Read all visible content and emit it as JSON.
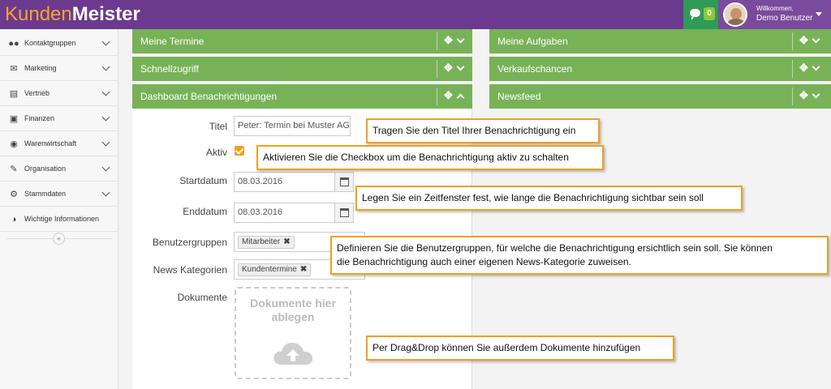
{
  "app": {
    "logo_part1": "Kunden",
    "logo_part2": "Meister",
    "chat_count": "0",
    "welcome": "Willkommen,",
    "username": "Demo Benutzer"
  },
  "sidebar": {
    "items": [
      {
        "label": "Kontaktgruppen",
        "icon": "users-icon"
      },
      {
        "label": "Marketing",
        "icon": "envelope-icon"
      },
      {
        "label": "Vertrieb",
        "icon": "bar-chart-icon"
      },
      {
        "label": "Finanzen",
        "icon": "money-icon"
      },
      {
        "label": "Warenwirtschaft",
        "icon": "globe-icon"
      },
      {
        "label": "Organisation",
        "icon": "edit-icon"
      },
      {
        "label": "Stammdaten",
        "icon": "cogs-icon"
      },
      {
        "label": "Wichtige Informationen",
        "icon": "half-circle-icon"
      }
    ],
    "collapse_glyph": "«"
  },
  "panels": {
    "left": [
      "Meine Termine",
      "Schnellzugriff",
      "Dashboard Benachrichtigungen"
    ],
    "right": [
      "Meine Aufgaben",
      "Verkaufschancen",
      "Newsfeed"
    ]
  },
  "form": {
    "title_label": "Titel",
    "title_value": "Peter: Termin bei Muster AG",
    "active_label": "Aktiv",
    "active_checked": true,
    "start_label": "Startdatum",
    "start_value": "08.03.2016",
    "end_label": "Enddatum",
    "end_value": "08.03.2016",
    "groups_label": "Benutzergruppen",
    "groups_tag": "Mitarbeiter",
    "news_label": "News Kategorien",
    "news_tag": "Kundentermine",
    "docs_label": "Dokumente",
    "dropzone_text_1": "Dokumente hier",
    "dropzone_text_2": "ablegen",
    "tag_remove": "✖"
  },
  "callouts": {
    "title": "Tragen Sie den Titel Ihrer Benachrichtigung ein",
    "active": "Aktivieren Sie die Checkbox um die Benachrichtigung aktiv zu schalten",
    "dates": "Legen Sie ein Zeitfenster fest, wie lange die Benachrichtigung sichtbar sein soll",
    "groups_line1": "Definieren Sie die Benutzergruppen, für welche die Benachrichtigung ersichtlich sein soll. Sie können",
    "groups_line2": "die Benachrichtigung auch einer eigenen News-Kategorie zuweisen.",
    "docs": "Per Drag&Drop können Sie außerdem Dokumente hinzufügen"
  },
  "colors": {
    "header": "#6b3a8e",
    "panel_green": "#78b257",
    "callout_border": "#f0a020",
    "chat_green": "#2e9b57"
  }
}
